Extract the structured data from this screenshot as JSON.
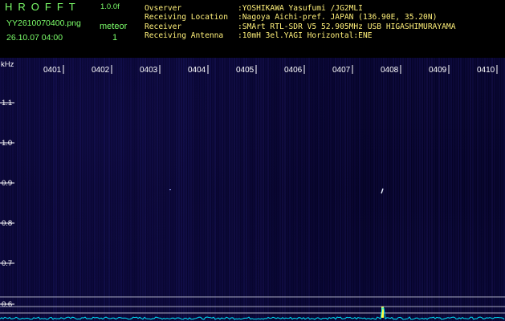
{
  "header": {
    "app_title": "HROFFT",
    "app_version": "1.0.0f",
    "file_name": "YY2610070400.png",
    "mode_label": "meteor",
    "timestamp": "26.10.07 04:00",
    "meteor_count": "1"
  },
  "station_info": [
    {
      "key": "Ovserver",
      "value": ":YOSHIKAWA Yasufumi /JG2MLI"
    },
    {
      "key": "Receiving Location",
      "value": ":Nagoya Aichi-pref. JAPAN (136.90E, 35.20N)"
    },
    {
      "key": "Receiver",
      "value": ":SMArt RTL-SDR V5 52.905MHz USB HIGASHIMURAYAMA"
    },
    {
      "key": "Receiving Antenna",
      "value": ":10mH 3el.YAGI Horizontal:ENE"
    }
  ],
  "spectrogram": {
    "freq_unit_label": "kHz",
    "freq_ticks": [
      "1.1",
      "1.0",
      "0.9",
      "0.8",
      "0.7",
      "0.6"
    ],
    "time_labels": [
      "0401",
      "0402",
      "0403",
      "0404",
      "0405",
      "0406",
      "0407",
      "0408",
      "0409",
      "0410"
    ]
  },
  "colors": {
    "header_green": "#7cff6a",
    "header_yellow": "#fff07a",
    "background": "#000000",
    "spectrum_trace": "#00e8ff",
    "echo": "#ffff40"
  }
}
